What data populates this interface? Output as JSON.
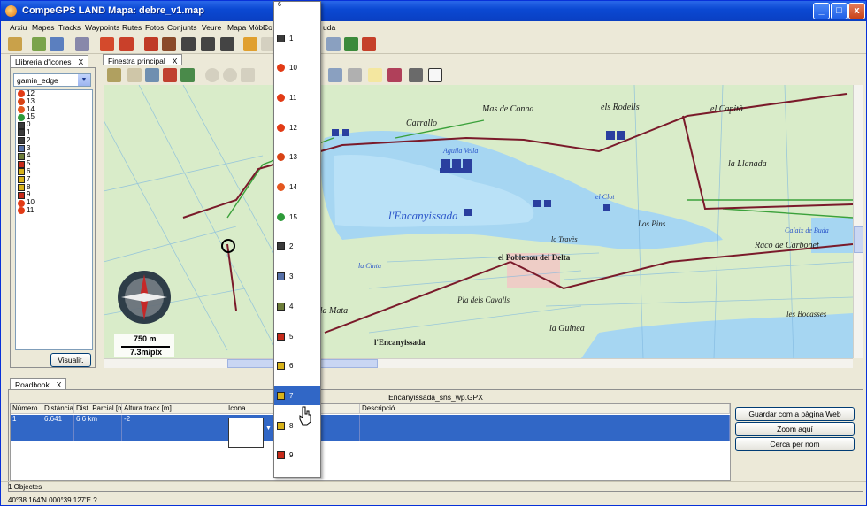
{
  "window": {
    "title": "CompeGPS LAND Mapa: debre_v1.map",
    "minimize": "_",
    "maximize": "□",
    "close": "x"
  },
  "menu": [
    "Arxiu",
    "Mapes",
    "Tracks",
    "Waypoints",
    "Rutes",
    "Fotos",
    "Conjunts",
    "Veure",
    "Mapa Mòbil",
    "Co",
    "uda"
  ],
  "left_panel": {
    "tab_label": "Llibreria d'icones",
    "tab_close": "X",
    "selected_library": "gamin_edge",
    "icons": [
      {
        "label": "12",
        "color": "#e23b16",
        "shape": "circle"
      },
      {
        "label": "13",
        "color": "#d84315",
        "shape": "circle"
      },
      {
        "label": "14",
        "color": "#e4571f",
        "shape": "circle"
      },
      {
        "label": "15",
        "color": "#2e9b3a",
        "shape": "circle"
      },
      {
        "label": "0",
        "color": "#3a3a3a",
        "shape": "square"
      },
      {
        "label": "1",
        "color": "#3a3a3a",
        "shape": "square"
      },
      {
        "label": "2",
        "color": "#3a3a3a",
        "shape": "square"
      },
      {
        "label": "3",
        "color": "#5670a8",
        "shape": "square"
      },
      {
        "label": "4",
        "color": "#6d7d3a",
        "shape": "square"
      },
      {
        "label": "5",
        "color": "#c62a1a",
        "shape": "square"
      },
      {
        "label": "6",
        "color": "#d7b21a",
        "shape": "square"
      },
      {
        "label": "7",
        "color": "#d7b21a",
        "shape": "square"
      },
      {
        "label": "8",
        "color": "#d7b21a",
        "shape": "square"
      },
      {
        "label": "9",
        "color": "#c62a1a",
        "shape": "square"
      },
      {
        "label": "10",
        "color": "#e23b16",
        "shape": "circle"
      },
      {
        "label": "11",
        "color": "#e23b16",
        "shape": "circle"
      }
    ],
    "visualize_button": "Visualit."
  },
  "main_tab": {
    "label": "Finestra principal",
    "close": "X"
  },
  "map": {
    "scale_distance": "750 m",
    "scale_resolution": "7.3m/pix",
    "labels": [
      {
        "text": "Carrallo"
      },
      {
        "text": "Mas de Conna"
      },
      {
        "text": "els Rodells"
      },
      {
        "text": "el Capità"
      },
      {
        "text": "la Llanada"
      },
      {
        "text": "l'Encanyissada"
      },
      {
        "text": "Los Pins"
      },
      {
        "text": "Racó de Carbonet"
      },
      {
        "text": "el Poblenou del Delta"
      },
      {
        "text": "Pla dels Cavalls"
      },
      {
        "text": "la Guinea"
      },
      {
        "text": "les Bocasses"
      },
      {
        "text": "l'Encanyissada"
      },
      {
        "text": "la Cinta"
      },
      {
        "text": "el Clot"
      },
      {
        "text": "es de la Mata"
      },
      {
        "text": "Calaix de Buda"
      },
      {
        "text": "Aguila Vella"
      },
      {
        "text": "lo Travès"
      }
    ]
  },
  "dropdown": {
    "items": [
      {
        "label": "1",
        "color": "#3a3a3a",
        "shape": "square"
      },
      {
        "label": "10",
        "color": "#e23b16",
        "shape": "circle"
      },
      {
        "label": "11",
        "color": "#e23b16",
        "shape": "circle"
      },
      {
        "label": "12",
        "color": "#e23b16",
        "shape": "circle"
      },
      {
        "label": "13",
        "color": "#d84315",
        "shape": "circle"
      },
      {
        "label": "14",
        "color": "#e4571f",
        "shape": "circle"
      },
      {
        "label": "15",
        "color": "#2e9b3a",
        "shape": "circle"
      },
      {
        "label": "2",
        "color": "#3a3a3a",
        "shape": "square"
      },
      {
        "label": "3",
        "color": "#5670a8",
        "shape": "square"
      },
      {
        "label": "4",
        "color": "#6d7d3a",
        "shape": "square"
      },
      {
        "label": "5",
        "color": "#c62a1a",
        "shape": "square"
      },
      {
        "label": "6",
        "color": "#d7b21a",
        "shape": "square"
      },
      {
        "label": "7",
        "color": "#d7b21a",
        "shape": "square",
        "selected": true
      },
      {
        "label": "8",
        "color": "#d7b21a",
        "shape": "square"
      },
      {
        "label": "9",
        "color": "#c62a1a",
        "shape": "square"
      }
    ]
  },
  "roadbook": {
    "tab_label": "Roadbook",
    "tab_close": "X",
    "file_title": "Encanyissada_sns_wp.GPX",
    "columns": [
      "Número",
      "Distància",
      "Dist. Parcial [m]",
      "Altura track [m]",
      "Icona",
      "Descripció"
    ],
    "row": {
      "numero": "1",
      "distancia": "6.641",
      "parcial": "6.6 km",
      "altura": "-2",
      "icona": "",
      "descripcio": ""
    },
    "buttons": [
      "Guardar com a pàgina Web",
      "Zoom aquí",
      "Cerca per nom"
    ],
    "objects": "1 Objectes"
  },
  "status": {
    "coords": "40°38.164'N 000°39.127'E ?"
  }
}
